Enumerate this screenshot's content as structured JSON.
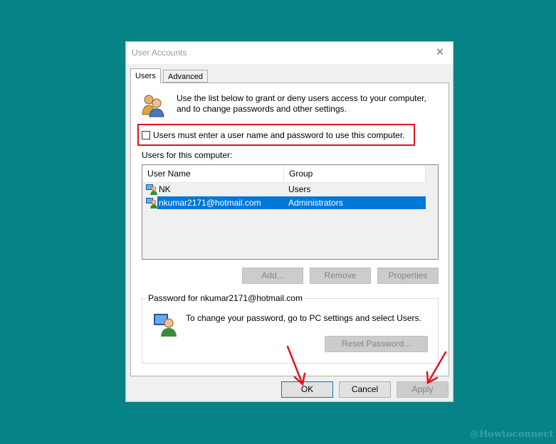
{
  "window": {
    "title": "User Accounts",
    "close_glyph": "✕"
  },
  "tabs": [
    {
      "label": "Users",
      "active": true
    },
    {
      "label": "Advanced",
      "active": false
    }
  ],
  "intro_text": "Use the list below to grant or deny users access to your computer, and to change passwords and other settings.",
  "login_checkbox": {
    "label": "Users must enter a user name and password to use this computer.",
    "checked": false
  },
  "users_section_label": "Users for this computer:",
  "user_table": {
    "columns": [
      "User Name",
      "Group"
    ],
    "rows": [
      {
        "name": "NK",
        "group": "Users",
        "selected": false
      },
      {
        "name": "nkumar2171@hotmail.com",
        "group": "Administrators",
        "selected": true
      }
    ]
  },
  "list_buttons": {
    "add": "Add...",
    "remove": "Remove",
    "properties": "Properties"
  },
  "password_group": {
    "label": "Password for nkumar2171@hotmail.com",
    "text": "To change your password, go to PC settings and select Users.",
    "reset_label": "Reset Password..."
  },
  "dialog_buttons": {
    "ok": "OK",
    "cancel": "Cancel",
    "apply": "Apply"
  },
  "watermark": "@Howtoconnect",
  "colors": {
    "background": "#058387",
    "highlight": "#e0141e",
    "selection": "#0078d7"
  },
  "icons": [
    "users-icon",
    "user-icon",
    "close-icon",
    "arrow-annotation"
  ]
}
